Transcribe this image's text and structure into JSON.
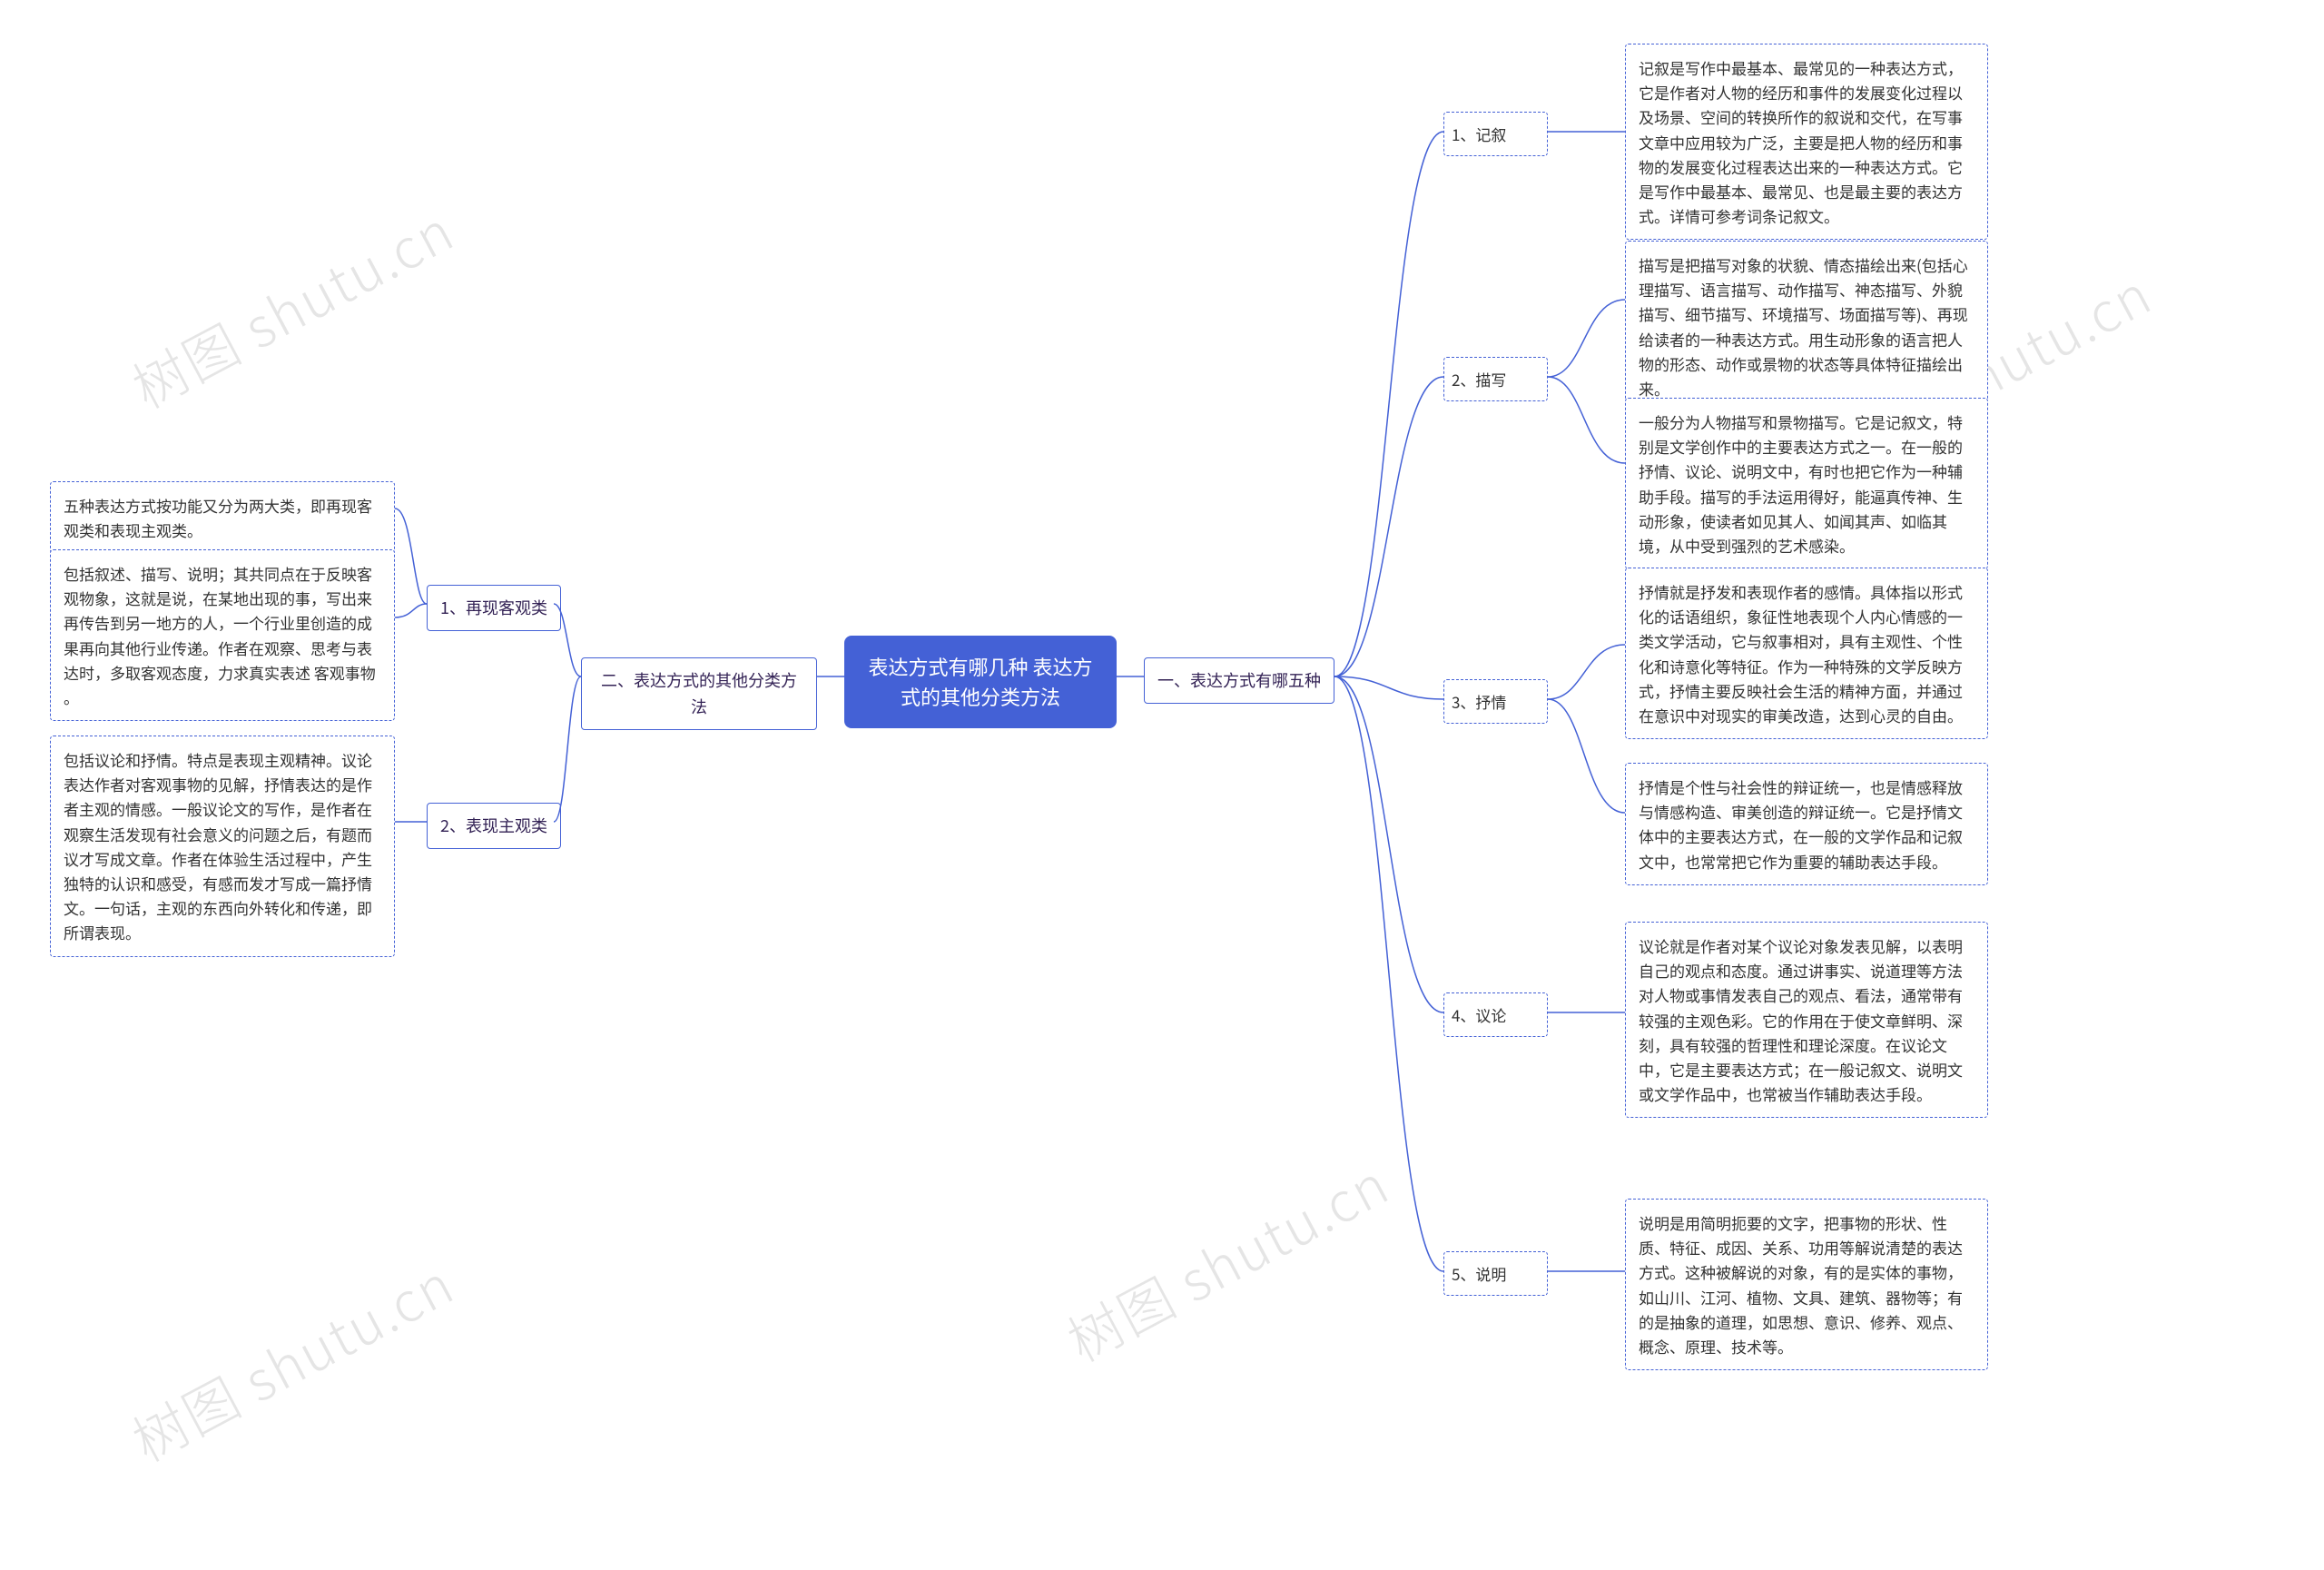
{
  "root": {
    "line1": "表达方式有哪几种 表达方",
    "line2": "式的其他分类方法"
  },
  "left": {
    "main": "二、表达方式的其他分类方法",
    "items": [
      {
        "label": "1、再现客观类"
      },
      {
        "label": "2、表现主观类"
      }
    ],
    "detail_summary": "五种表达方式按功能又分为两大类，即再现客观类和表现主观类。",
    "detail_1": "包括叙述、描写、说明；其共同点在于反映客观物象，这就是说，在某地出现的事，写出来再传告到另一地方的人，一个行业里创造的成果再向其他行业传递。作者在观察、思考与表达时，多取客观态度，力求真实表述 客观事物 。",
    "detail_2": "包括议论和抒情。特点是表现主观精神。议论表达作者对客观事物的见解，抒情表达的是作者主观的情感。一般议论文的写作，是作者在观察生活发现有社会意义的问题之后，有题而议才写成文章。作者在体验生活过程中，产生独特的认识和感受，有感而发才写成一篇抒情文。一句话，主观的东西向外转化和传递，即所谓表现。"
  },
  "right": {
    "main": "一、表达方式有哪五种",
    "items": [
      {
        "label": "1、记叙"
      },
      {
        "label": "2、描写"
      },
      {
        "label": "3、抒情"
      },
      {
        "label": "4、议论"
      },
      {
        "label": "5、说明"
      }
    ],
    "detail_1a": "记叙是写作中最基本、最常见的一种表达方式，它是作者对人物的经历和事件的发展变化过程以及场景、空间的转换所作的叙说和交代，在写事文章中应用较为广泛，主要是把人物的经历和事物的发展变化过程表达出来的一种表达方式。它是写作中最基本、最常见、也是最主要的表达方式。详情可参考词条记叙文。",
    "detail_2a": "描写是把描写对象的状貌、情态描绘出来(包括心理描写、语言描写、动作描写、神态描写、外貌描写、细节描写、环境描写、场面描写等)、再现给读者的一种表达方式。用生动形象的语言把人物的形态、动作或景物的状态等具体特征描绘出来。",
    "detail_2b": "一般分为人物描写和景物描写。它是记叙文，特别是文学创作中的主要表达方式之一。在一般的抒情、议论、说明文中，有时也把它作为一种辅助手段。描写的手法运用得好，能逼真传神、生动形象，使读者如见其人、如闻其声、如临其境，从中受到强烈的艺术感染。",
    "detail_3a": "抒情就是抒发和表现作者的感情。具体指以形式化的话语组织，象征性地表现个人内心情感的一类文学活动，它与叙事相对，具有主观性、个性化和诗意化等特征。作为一种特殊的文学反映方式，抒情主要反映社会生活的精神方面，并通过在意识中对现实的审美改造，达到心灵的自由。",
    "detail_3b": "抒情是个性与社会性的辩证统一，也是情感释放与情感构造、审美创造的辩证统一。它是抒情文体中的主要表达方式，在一般的文学作品和记叙文中，也常常把它作为重要的辅助表达手段。",
    "detail_4a": "议论就是作者对某个议论对象发表见解，以表明自己的观点和态度。通过讲事实、说道理等方法对人物或事情发表自己的观点、看法，通常带有较强的主观色彩。它的作用在于使文章鲜明、深刻，具有较强的哲理性和理论深度。在议论文中，它是主要表达方式；在一般记叙文、说明文或文学作品中，也常被当作辅助表达手段。",
    "detail_5a": "说明是用简明扼要的文字，把事物的形状、性质、特征、成因、关系、功用等解说清楚的表达方式。这种被解说的对象，有的是实体的事物，如山川、江河、植物、文具、建筑、器物等；有的是抽象的道理，如思想、意识、修养、观点、概念、原理、技术等。"
  },
  "watermark_text": "树图 shutu.cn"
}
